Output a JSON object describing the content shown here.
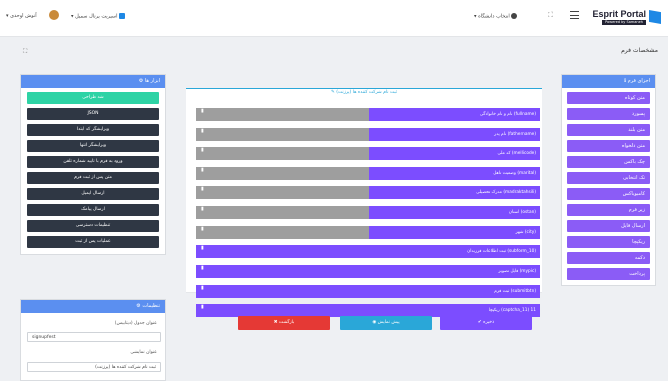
{
  "topbar": {
    "brand_title": "Esprit Portal",
    "brand_subtitle": "Powered by Samaneh",
    "university_select": "انتخاب دانشگاه",
    "portal_link": "اسپریت پرتال سمپل",
    "user_name": "آنوش اوحدی"
  },
  "page": {
    "title": "مشخصات فرم"
  },
  "form_elements": {
    "title": "اجزای فرم",
    "items": [
      "متن کوتاه",
      "پسورد",
      "متن بلند",
      "متن دلخواه",
      "چک باکس",
      "تک انتخابی",
      "کامبوباکس",
      "زیر فرم",
      "ارسال فایل",
      "ریکپچا",
      "دکمه",
      "پرداخت"
    ]
  },
  "tools": {
    "title": "ابزار ها",
    "items": [
      "شد طراحی",
      "JSON",
      "ویرایشگر کد ابتدا",
      "ویرایشگر انتها",
      "ورود به فرم با تایید شماره تلفن",
      "متن پس از ثبت فرم",
      "ارسال ایمیل",
      "ارسال پیامک",
      "تنظیمات دسترسی",
      "عملیات پس از ثبت"
    ]
  },
  "settings": {
    "title": "تنظیمات",
    "table_label": "عنوان جدول (دیتابیس)",
    "table_value": "signupfest",
    "display_label": "عنوان نمایشی",
    "display_value": "ثبت نام شرکت کننده ها (پرزنت)"
  },
  "canvas": {
    "title": "ثبت نام شرکت کننده ها (پرزنت)",
    "rows": [
      {
        "label": "نام و نام خانوادگی (fullname)",
        "split": true
      },
      {
        "label": "نام پدر (fathername)",
        "split": true
      },
      {
        "label": "کد ملی (mellicode)",
        "split": true
      },
      {
        "label": "وضعیت تاهل (marital)",
        "split": true
      },
      {
        "label": "مدرک تحصیلی (madraktahsili)",
        "split": true
      },
      {
        "label": "استان (ostan)",
        "split": true
      },
      {
        "label": "شهر (city)",
        "split": true
      },
      {
        "label": "ثبت اطلاعات فرزندان (subform_10)",
        "split": false
      },
      {
        "label": "فایل تصویر (mypic)",
        "split": false
      },
      {
        "label": "ثبت فرم (submitbtn)",
        "split": false
      },
      {
        "label": "ریکپچا (captcha_11) 11",
        "split": false
      }
    ],
    "trash_icon": "trash-icon"
  },
  "actions": {
    "save": "ذخیره",
    "preview": "پیش نمایش",
    "back": "بازگشت"
  },
  "colors": {
    "primary_blue": "#5b8ff0",
    "purple": "#7c4dff",
    "dark": "#2f3744",
    "teal": "#2ed3a5",
    "red": "#e53935",
    "cyan": "#2aa7d8",
    "gray": "#9e9e9e"
  }
}
